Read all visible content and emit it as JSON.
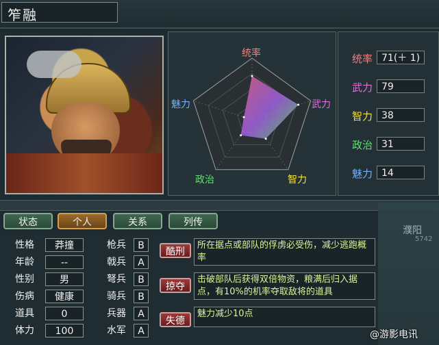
{
  "officer": {
    "name": "笮融"
  },
  "radar": {
    "labels": {
      "top": "统率",
      "right": "武力",
      "bottom_right": "智力",
      "bottom_left": "政治",
      "left": "魅力"
    },
    "values": {
      "统率": 71,
      "武力": 79,
      "智力": 38,
      "政治": 31,
      "魅力": 14
    },
    "max": 100
  },
  "stats": [
    {
      "label": "统率",
      "value": "71(＋ 1)",
      "color": "#f08080"
    },
    {
      "label": "武力",
      "value": "79",
      "color": "#e070e0"
    },
    {
      "label": "智力",
      "value": "38",
      "color": "#f0e040"
    },
    {
      "label": "政治",
      "value": "31",
      "color": "#60e070"
    },
    {
      "label": "魅力",
      "value": "14",
      "color": "#70b0ff"
    }
  ],
  "tabs": [
    {
      "label": "状态",
      "active": false
    },
    {
      "label": "个人",
      "active": true
    },
    {
      "label": "关系",
      "active": false
    },
    {
      "label": "列传",
      "active": false
    }
  ],
  "personal": [
    {
      "label": "性格",
      "value": "莽撞"
    },
    {
      "label": "年龄",
      "value": "--"
    },
    {
      "label": "性别",
      "value": "男"
    },
    {
      "label": "伤病",
      "value": "健康"
    },
    {
      "label": "道具",
      "value": "0"
    },
    {
      "label": "体力",
      "value": "100"
    }
  ],
  "aptitude": [
    {
      "label": "枪兵",
      "grade": "B"
    },
    {
      "label": "戟兵",
      "grade": "A"
    },
    {
      "label": "弩兵",
      "grade": "B"
    },
    {
      "label": "骑兵",
      "grade": "B"
    },
    {
      "label": "兵器",
      "grade": "A"
    },
    {
      "label": "水军",
      "grade": "A"
    }
  ],
  "skills": [
    {
      "name": "酷刑",
      "desc": "所在据点或部队的俘虏必受伤，减少逃跑概率"
    },
    {
      "name": "掠夺",
      "desc": "击破部队后获得双倍物资，粮满后归入据点，有10%的机率夺取敌将的道具"
    },
    {
      "name": "失德",
      "desc": "魅力减少10点"
    }
  ],
  "map": {
    "city": "濮阳",
    "number": "5742"
  },
  "watermark": "@游影电讯"
}
